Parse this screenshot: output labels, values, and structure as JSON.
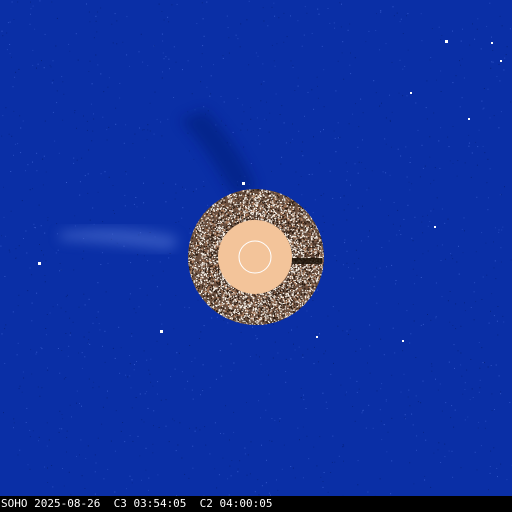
{
  "image": {
    "subject": "SOHO LASCO C3/C2 composite coronagraph difference image",
    "colors": {
      "background": "#0a2fa6",
      "occulter_disk": "#f3c49a",
      "inner_ring": "#ffffff",
      "speckle_light": "#f5f0e8",
      "speckle_dark": "#2a1a10",
      "caption_bar": "#000000",
      "caption_text": "#ffffff"
    }
  },
  "caption": {
    "text": "SOHO 2025-08-26  C3 03:54:05  C2 04:00:05"
  }
}
